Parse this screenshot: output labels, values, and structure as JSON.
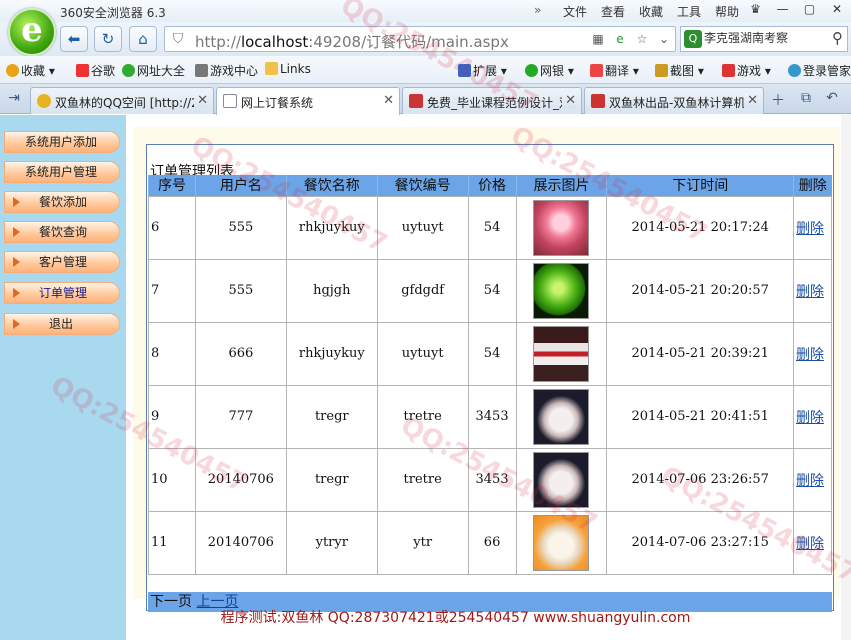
{
  "browser": {
    "title": "360安全浏览器 6.3",
    "menu": [
      "文件",
      "查看",
      "收藏",
      "工具",
      "帮助"
    ],
    "window_controls": [
      "♛",
      "—",
      "▢",
      "✕"
    ],
    "url_host": "http://",
    "url_main": "localhost",
    "url_rest": ":49208/订餐代码/main.aspx",
    "search_value": "李克强湖南考察"
  },
  "favorites": [
    {
      "label": "收藏",
      "color": "#e8a317"
    },
    {
      "label": "谷歌",
      "color": "#e33"
    },
    {
      "label": "网址大全",
      "color": "#3a3"
    },
    {
      "label": "游戏中心",
      "color": "#777"
    },
    {
      "label": "Links",
      "color": "#f0c14b"
    },
    {
      "label": "扩展",
      "color": "#36c"
    },
    {
      "label": "网银",
      "color": "#2a2"
    },
    {
      "label": "翻译",
      "color": "#e44"
    },
    {
      "label": "截图",
      "color": "#c92"
    },
    {
      "label": "游戏",
      "color": "#d33"
    },
    {
      "label": "登录管家",
      "color": "#39c"
    }
  ],
  "tabs": [
    {
      "label": "双鱼林的QQ空间 [http://2",
      "color": "#e8b320"
    },
    {
      "label": "网上订餐系统",
      "color": "#eef"
    },
    {
      "label": "免费_毕业课程范例设计_双",
      "color": "#c33"
    },
    {
      "label": "双鱼林出品-双鱼林计算机.",
      "color": "#c33"
    }
  ],
  "sidebar": {
    "items": [
      {
        "label": "系统用户添加"
      },
      {
        "label": "系统用户管理"
      },
      {
        "label": "餐饮添加"
      },
      {
        "label": "餐饮查询"
      },
      {
        "label": "客户管理"
      },
      {
        "label": "订单管理"
      },
      {
        "label": "退出"
      }
    ]
  },
  "orders": {
    "caption": "订单管理列表",
    "columns": [
      "序号",
      "用户名",
      "餐饮名称",
      "餐饮编号",
      "价格",
      "展示图片",
      "下订时间",
      "删除"
    ],
    "rows": [
      {
        "id": "6",
        "user": "555",
        "name": "rhkjuykuy",
        "code": "uytuyt",
        "price": "54",
        "image": "pink-drink",
        "time": "2014-05-21 20:17:24",
        "action": "删除"
      },
      {
        "id": "7",
        "user": "555",
        "name": "hgjgh",
        "code": "gfdgdf",
        "price": "54",
        "image": "green-apple",
        "time": "2014-05-21 20:20:57",
        "action": "删除"
      },
      {
        "id": "8",
        "user": "666",
        "name": "rhkjuykuy",
        "code": "uytuyt",
        "price": "54",
        "image": "dessert-cups",
        "time": "2014-05-21 20:39:21",
        "action": "删除"
      },
      {
        "id": "9",
        "user": "777",
        "name": "tregr",
        "code": "tretre",
        "price": "3453",
        "image": "rice-bowl",
        "time": "2014-05-21 20:41:51",
        "action": "删除"
      },
      {
        "id": "10",
        "user": "20140706",
        "name": "tregr",
        "code": "tretre",
        "price": "3453",
        "image": "rice-bowl",
        "time": "2014-07-06 23:26:57",
        "action": "删除"
      },
      {
        "id": "11",
        "user": "20140706",
        "name": "ytryr",
        "code": "ytr",
        "price": "66",
        "image": "soup-bowl",
        "time": "2014-07-06 23:27:15",
        "action": "删除"
      }
    ],
    "pager": {
      "next": "下一页",
      "prev": "上一页"
    }
  },
  "footer": "程序测试:双鱼林 QQ:287307421或254540457 www.shuangyulin.com"
}
